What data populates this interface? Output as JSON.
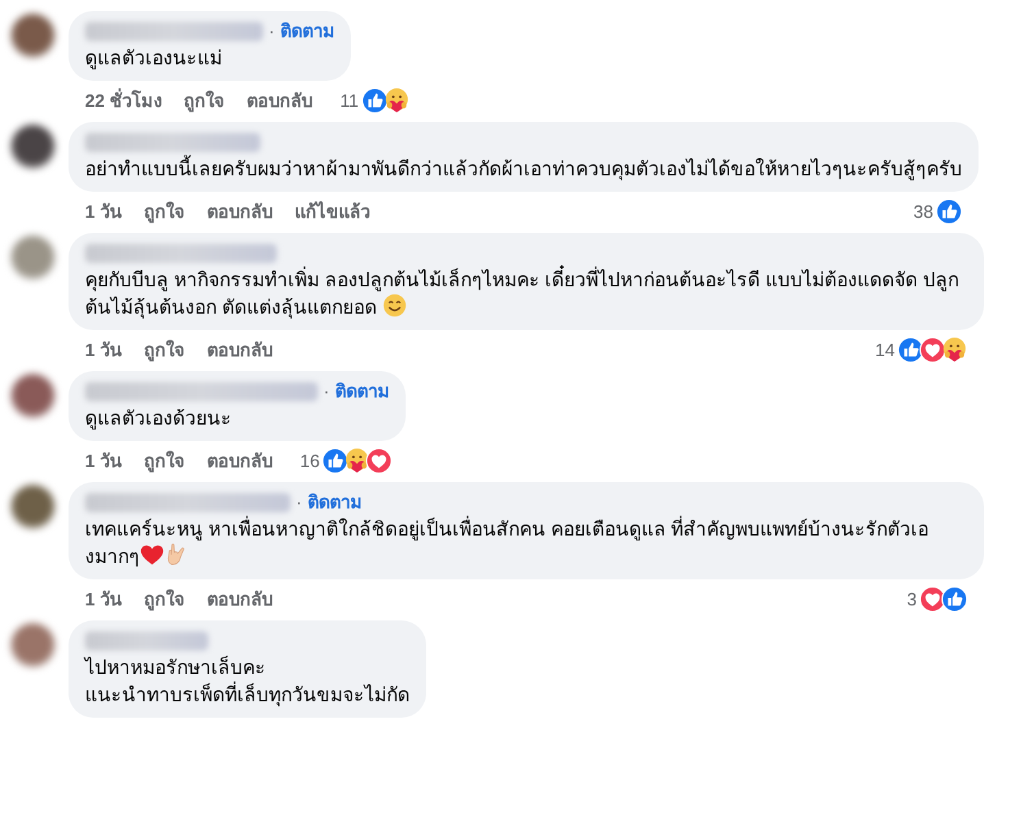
{
  "comments": [
    {
      "follow": {
        "separator": "·",
        "label": "ติดตาม"
      },
      "text": "ดูแลตัวเองนะแม่",
      "time": "22 ชั่วโมง",
      "like": "ถูกใจ",
      "reply": "ตอบกลับ",
      "reaction_count": "11",
      "reactions": [
        {
          "kind": "like"
        },
        {
          "kind": "care"
        }
      ]
    },
    {
      "text": "อย่าทำแบบนี้เลยครับผมว่าหาผ้ามาพันดีกว่าแล้วกัดผ้าเอาท่าควบคุมตัวเองไม่ได้ขอให้หายไวๆนะครับสู้ๆครับ",
      "time": "1 วัน",
      "like": "ถูกใจ",
      "reply": "ตอบกลับ",
      "edited": "แก้ไขแล้ว",
      "reaction_count": "38",
      "reactions": [
        {
          "kind": "like"
        }
      ]
    },
    {
      "text": "คุยกับบีบลู หากิจกรรมทำเพิ่ม ลองปลูกต้นไม้เล็กๆไหมคะ เดี๋ยวพี่ไปหาก่อนต้นอะไรดี แบบไม่ต้องแดดจัด ปลูกต้นไม้ลุ้นต้นงอก ตัดแต่งลุ้นแตกยอด",
      "emojis": [
        {
          "kind": "smile"
        }
      ],
      "time": "1 วัน",
      "like": "ถูกใจ",
      "reply": "ตอบกลับ",
      "reaction_count": "14",
      "reactions": [
        {
          "kind": "like"
        },
        {
          "kind": "love"
        },
        {
          "kind": "care"
        }
      ]
    },
    {
      "follow": {
        "separator": "·",
        "label": "ติดตาม"
      },
      "text": "ดูแลตัวเองด้วยนะ",
      "time": "1 วัน",
      "like": "ถูกใจ",
      "reply": "ตอบกลับ",
      "reaction_count": "16",
      "reactions": [
        {
          "kind": "like"
        },
        {
          "kind": "care"
        },
        {
          "kind": "love"
        }
      ]
    },
    {
      "follow": {
        "separator": "·",
        "label": "ติดตาม"
      },
      "text": "เทคแคร์นะหนู หาเพื่อนหาญาติใกล้ชิดอยู่เป็นเพื่อนสักคน คอยเตือนดูแล ที่สำคัญพบแพทย์บ้างนะรักตัวเองมากๆ",
      "emojis": [
        {
          "kind": "heart"
        },
        {
          "kind": "hand"
        }
      ],
      "time": "1 วัน",
      "like": "ถูกใจ",
      "reply": "ตอบกลับ",
      "reaction_count": "3",
      "reactions": [
        {
          "kind": "love"
        },
        {
          "kind": "like"
        }
      ]
    },
    {
      "text": "ไปหาหมอรักษาเล็บคะ\nแนะนำทาบรเพ็ดที่เล็บทุกวันขมจะไม่กัด"
    }
  ]
}
